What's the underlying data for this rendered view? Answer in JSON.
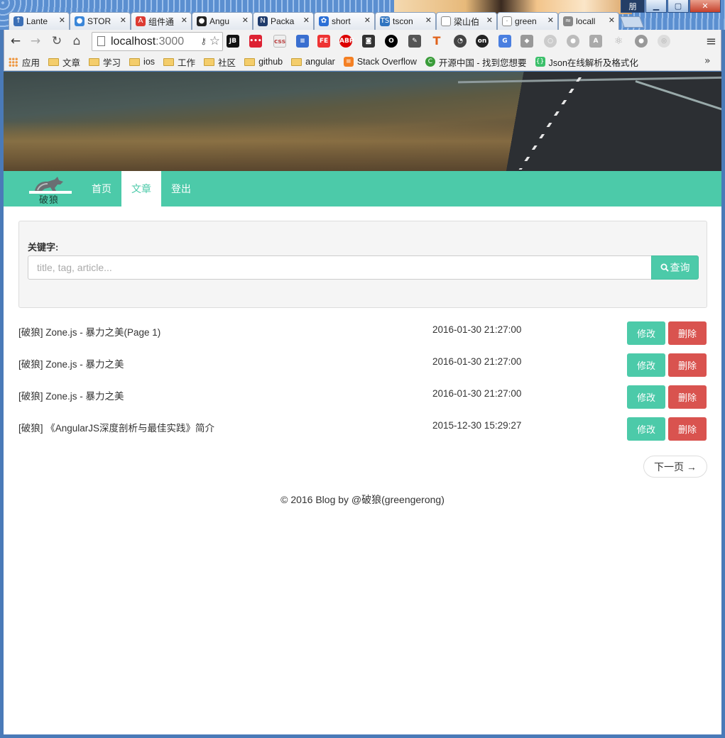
{
  "browser": {
    "tabs": [
      {
        "label": "Lante",
        "icon": "lantern-icon",
        "color": "#3b6fb6",
        "glyph": "↑"
      },
      {
        "label": "STOR",
        "icon": "storage-icon",
        "color": "#3a86d8",
        "glyph": "●"
      },
      {
        "label": "组件通",
        "icon": "angular-icon",
        "color": "#dd3b33",
        "glyph": "A"
      },
      {
        "label": "Angu",
        "icon": "github-icon",
        "color": "#222222",
        "glyph": "●"
      },
      {
        "label": "Packa",
        "icon": "nuget-icon",
        "color": "#1e3a6b",
        "glyph": "N"
      },
      {
        "label": "short",
        "icon": "paw-icon",
        "color": "#2b6fd6",
        "glyph": "✿"
      },
      {
        "label": "tscon",
        "icon": "typescript-icon",
        "color": "#2f74c0",
        "glyph": "TS"
      },
      {
        "label": "梁山伯",
        "icon": "page-icon",
        "color": "#ffffff",
        "glyph": ""
      },
      {
        "label": "green",
        "icon": "dot-icon",
        "color": "#ffffff",
        "glyph": "·"
      },
      {
        "label": "locall",
        "icon": "wolf-tab-icon",
        "color": "#888888",
        "glyph": "≈",
        "active": true
      }
    ],
    "window_user": "朋",
    "url_host": "localhost",
    "url_port": ":3000",
    "bookmarks": [
      {
        "label": "应用",
        "kind": "apps"
      },
      {
        "label": "文章",
        "kind": "folder"
      },
      {
        "label": "学习",
        "kind": "folder"
      },
      {
        "label": "ios",
        "kind": "folder"
      },
      {
        "label": "工作",
        "kind": "folder"
      },
      {
        "label": "社区",
        "kind": "folder"
      },
      {
        "label": "github",
        "kind": "folder"
      },
      {
        "label": "angular",
        "kind": "folder"
      },
      {
        "label": "Stack Overflow",
        "kind": "stackoverflow"
      },
      {
        "label": "开源中国 - 找到您想要",
        "kind": "oschina"
      },
      {
        "label": "Json在线解析及格式化",
        "kind": "json"
      }
    ]
  },
  "site": {
    "logo_text": "破狼",
    "nav": [
      {
        "label": "首页",
        "active": false
      },
      {
        "label": "文章",
        "active": true
      },
      {
        "label": "登出",
        "active": false
      }
    ],
    "accent": "#4ccaa9",
    "danger": "#d9534f"
  },
  "search": {
    "label": "关键字:",
    "placeholder": "title, tag, article...",
    "value": "",
    "button_label": "查询"
  },
  "articles": [
    {
      "title": "[破狼] Zone.js - 暴力之美(Page 1)",
      "date": "2016-01-30 21:27:00"
    },
    {
      "title": "[破狼] Zone.js - 暴力之美",
      "date": "2016-01-30 21:27:00"
    },
    {
      "title": "[破狼] Zone.js - 暴力之美",
      "date": "2016-01-30 21:27:00"
    },
    {
      "title": "[破狼] 《AngularJS深度剖析与最佳实践》简介",
      "date": "2015-12-30 15:29:27"
    }
  ],
  "actions": {
    "edit_label": "修改",
    "delete_label": "删除"
  },
  "pager": {
    "next_label": "下一页 →"
  },
  "footer": {
    "text": "© 2016 Blog by @破狼(greengerong)"
  }
}
